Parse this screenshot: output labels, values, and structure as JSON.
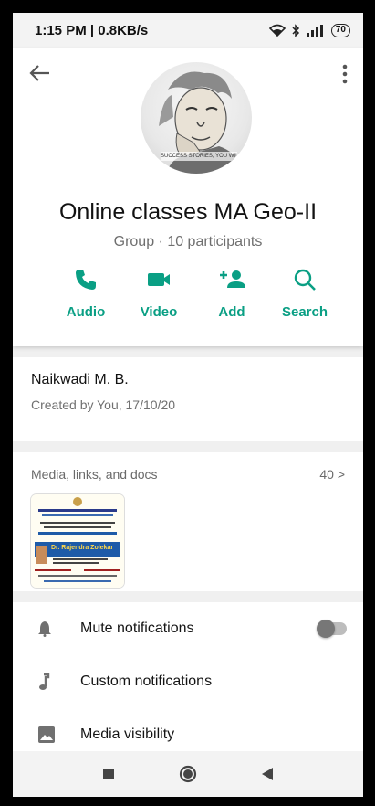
{
  "status_bar": {
    "time_speed": "1:15 PM | 0.8KB/s",
    "battery": "70",
    "icons": [
      "wifi-icon",
      "bluetooth-icon",
      "signal-icon",
      "battery-icon"
    ]
  },
  "header": {
    "avatar_caption": "SUCCESS STORIES, YOU WIL",
    "title": "Online classes MA Geo-II",
    "subtitle": "Group · 10 participants",
    "actions": [
      {
        "label": "Audio",
        "icon": "phone-icon"
      },
      {
        "label": "Video",
        "icon": "video-icon"
      },
      {
        "label": "Add",
        "icon": "add-person-icon"
      },
      {
        "label": "Search",
        "icon": "search-icon"
      }
    ]
  },
  "description": {
    "title": "Naikwadi M. B.",
    "created": "Created by You, 17/10/20"
  },
  "media": {
    "label": "Media, links, and docs",
    "count": "40 >",
    "thumb_title": "Dr. Rajendra Zolekar"
  },
  "settings": [
    {
      "label": "Mute notifications",
      "icon": "bell-icon"
    },
    {
      "label": "Custom notifications",
      "icon": "music-note-icon"
    },
    {
      "label": "Media visibility",
      "icon": "image-icon"
    }
  ],
  "colors": {
    "accent": "#0a9f84",
    "text": "#121212",
    "muted": "#6f6f6f"
  }
}
